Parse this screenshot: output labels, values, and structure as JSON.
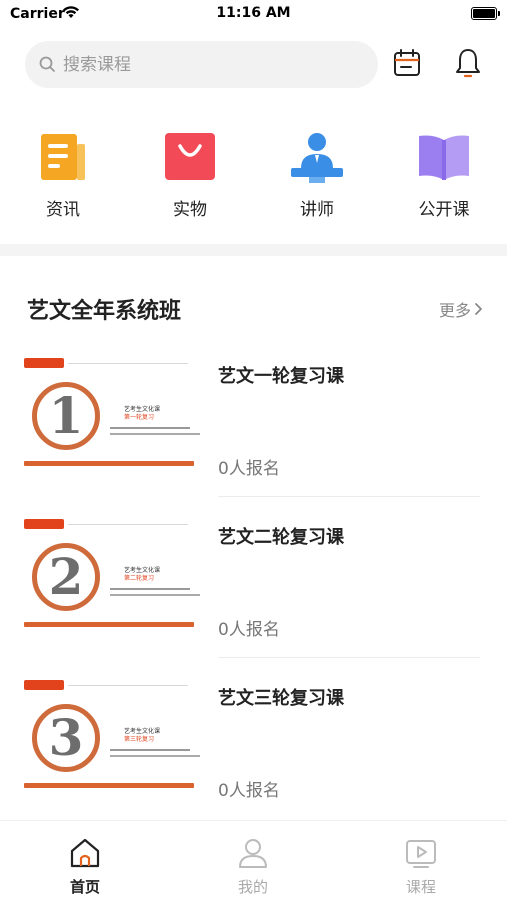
{
  "status_bar": {
    "carrier": "Carrier",
    "time": "11:16 AM"
  },
  "search": {
    "placeholder": "搜索课程",
    "value": ""
  },
  "header_icons": [
    "calendar-icon",
    "bell-icon"
  ],
  "categories": [
    {
      "label": "资讯",
      "icon": "news-icon",
      "color": "#f5a623"
    },
    {
      "label": "实物",
      "icon": "shopping-bag-icon",
      "color": "#f24b57"
    },
    {
      "label": "讲师",
      "icon": "lecturer-icon",
      "color": "#3a8ee6"
    },
    {
      "label": "公开课",
      "icon": "open-book-icon",
      "color": "#9b7ff0"
    }
  ],
  "section": {
    "title": "艺文全年系统班",
    "more": "更多"
  },
  "courses": [
    {
      "title": "艺文一轮复习课",
      "enrolled": "0人报名",
      "thumb_number": "1",
      "thumb_title": "艺考生文化课",
      "thumb_subtitle": "第一轮复习"
    },
    {
      "title": "艺文二轮复习课",
      "enrolled": "0人报名",
      "thumb_number": "2",
      "thumb_title": "艺考生文化课",
      "thumb_subtitle": "第二轮复习"
    },
    {
      "title": "艺文三轮复习课",
      "enrolled": "0人报名",
      "thumb_number": "3",
      "thumb_title": "艺考生文化课",
      "thumb_subtitle": "第三轮复习"
    }
  ],
  "tabs": [
    {
      "label": "首页",
      "icon": "home-icon",
      "active": true
    },
    {
      "label": "我的",
      "icon": "profile-icon",
      "active": false
    },
    {
      "label": "课程",
      "icon": "course-play-icon",
      "active": false
    }
  ],
  "colors": {
    "accent": "#d9622e",
    "active_tab": "#222222",
    "inactive_tab": "#aaaaaa"
  }
}
